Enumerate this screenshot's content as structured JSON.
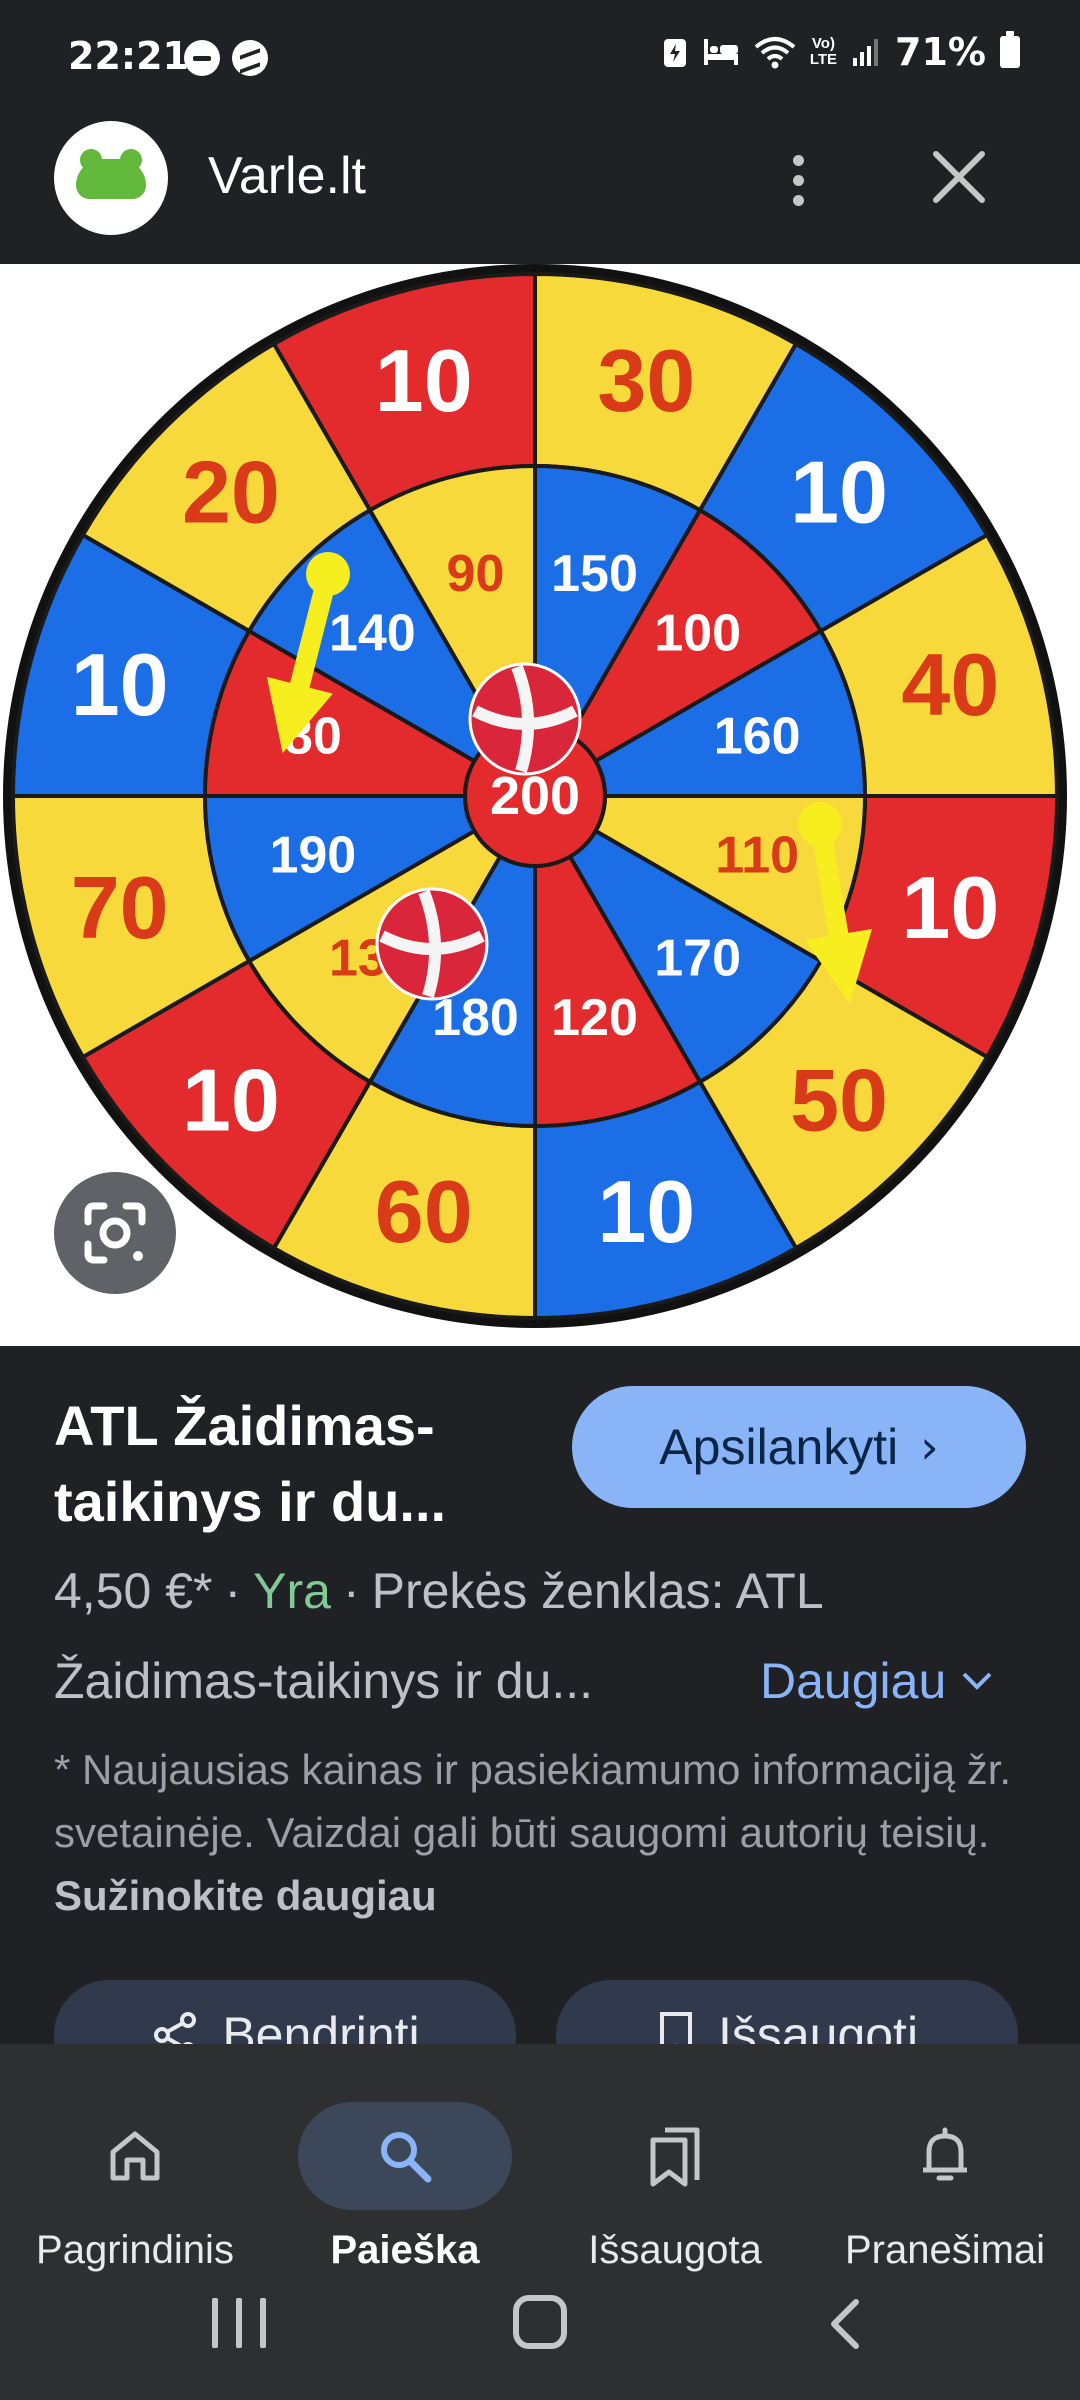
{
  "status_bar": {
    "time": "22:21",
    "battery": "71%",
    "lte_label": "Vo)\nLTE",
    "icons": [
      "do-not-disturb-icon",
      "messenger-icon",
      "battery-saver-icon",
      "bed-icon",
      "wifi-icon",
      "volte-icon",
      "signal-icon",
      "battery-icon"
    ]
  },
  "header": {
    "site_name": "Varle.lt",
    "logo": "frog-logo",
    "more_icon": "more-vert-icon",
    "close_icon": "close-icon"
  },
  "hero": {
    "image": "dartboard-product-photo",
    "lens_icon": "google-lens-icon",
    "outer_scores": [
      "30",
      "10",
      "40",
      "10",
      "50",
      "10",
      "60",
      "10",
      "70",
      "10",
      "20",
      "10"
    ],
    "inner_scores": [
      "150",
      "100",
      "160",
      "110",
      "170",
      "120",
      "180",
      "130",
      "190",
      "80",
      "140",
      "90"
    ],
    "bullseye": "200",
    "colors": {
      "red": "#e32b2d",
      "yellow": "#f7d93b",
      "blue": "#1b6ee6",
      "text_red": "#d93a18"
    }
  },
  "product": {
    "title": "ATL Žaidimas-taikinys ir du...",
    "visit_label": "Apsilankyti",
    "price": "4,50 €*",
    "availability": "Yra",
    "brand": "Prekės ženklas: ATL",
    "description": "Žaidimas-taikinys ir du...",
    "more_label": "Daugiau",
    "disclaimer": "* Naujausias kainas ir pasiekiamumo informaciją žr. svetainėje. Vaizdai gali būti saugomi autorių teisių.",
    "learn_more": "Sužinokite daugiau",
    "share_label": "Bendrinti",
    "save_label": "Išsaugoti"
  },
  "bottom_nav": {
    "items": [
      {
        "label": "Pagrindinis",
        "icon": "home-icon",
        "active": false
      },
      {
        "label": "Paieška",
        "icon": "search-icon",
        "active": true
      },
      {
        "label": "Išsaugota",
        "icon": "bookmarks-icon",
        "active": false
      },
      {
        "label": "Pranešimai",
        "icon": "bell-icon",
        "active": false
      }
    ]
  },
  "accent": {
    "link": "#8ab4f8",
    "in_stock": "#81c995"
  }
}
